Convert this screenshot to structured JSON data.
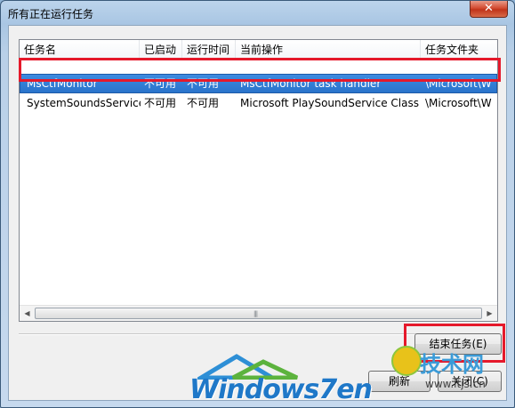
{
  "window": {
    "title": "所有正在运行任务",
    "close_glyph": "✕"
  },
  "columns": [
    "任务名",
    "已启动",
    "运行时间",
    "当前操作",
    "任务文件夹"
  ],
  "rows": [
    {
      "name": "MsCtfMonitor",
      "started": "不可用",
      "runtime": "不可用",
      "action": "MsCtfMonitor task handler",
      "folder": "\\Microsoft\\W",
      "selected": true
    },
    {
      "name": "SystemSoundsService",
      "started": "不可用",
      "runtime": "不可用",
      "action": "Microsoft PlaySoundService Class",
      "folder": "\\Microsoft\\W",
      "selected": false
    }
  ],
  "scrollbar": {
    "left_arrow": "◀",
    "right_arrow": "▶",
    "grip": "|||"
  },
  "buttons": {
    "end_task": "结束任务(E)",
    "refresh": "刷新",
    "close": "关闭(C)"
  },
  "watermark": {
    "brand": "Windows7en",
    "site_name": "技术网",
    "site_url": "www.itjs.cn"
  },
  "colors": {
    "selection": "#2a73cb",
    "highlight_box": "#e5192b"
  }
}
